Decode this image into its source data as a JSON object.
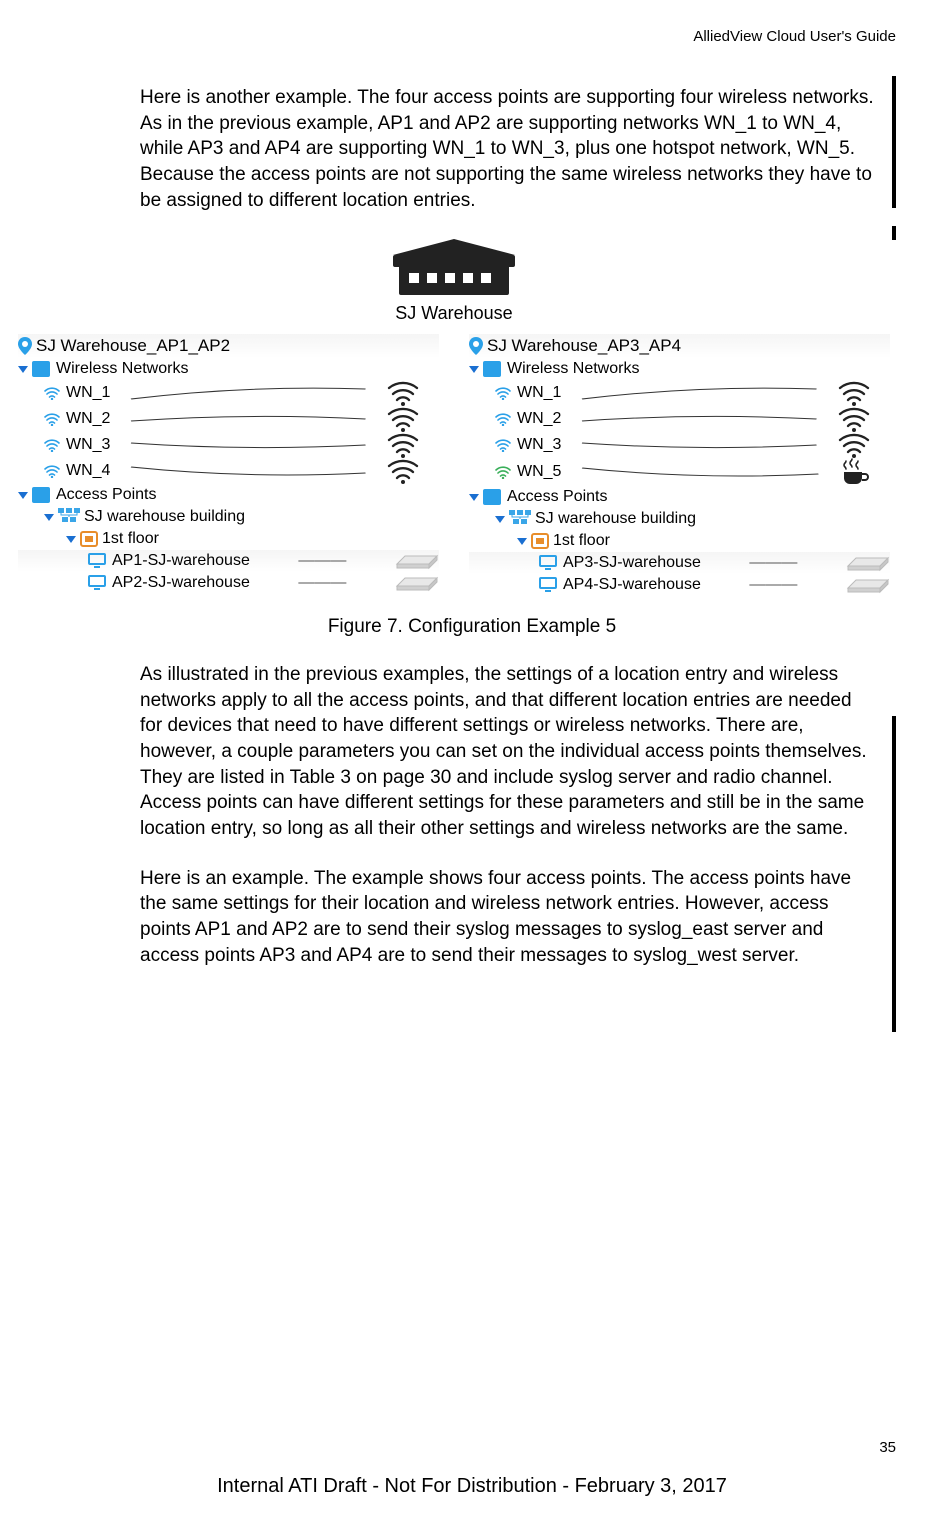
{
  "header": {
    "title": "AlliedView Cloud User's Guide"
  },
  "paragraphs": {
    "p1": "Here is another example. The four access points are supporting four wireless networks. As in the previous example, AP1 and AP2 are supporting networks WN_1 to WN_4, while AP3 and AP4 are supporting WN_1 to WN_3, plus one hotspot network, WN_5. Because the access points are not supporting the same wireless networks they have to be assigned to different location entries.",
    "p2": "As illustrated in the previous examples, the settings of a location entry and wireless networks apply to all the access points, and that different location entries are needed for devices that need to have different settings or wireless networks. There are, however, a couple parameters you can set on the individual access points themselves. They are listed in Table 3 on page 30 and include syslog server and radio channel. Access points can have different settings for these parameters and still be in the same location entry, so long as all their other settings and wireless networks are the same.",
    "p3": "Here is an example. The example shows four access points. The access points have the same settings for their location and wireless network entries. However, access points AP1 and AP2 are to send their syslog messages to syslog_east server and access points AP3 and AP4 are to send their messages to syslog_west server."
  },
  "figure": {
    "caption": "Figure 7. Configuration Example 5",
    "building_label": "SJ Warehouse",
    "left": {
      "location": "SJ Warehouse_AP1_AP2",
      "wireless_label": "Wireless Networks",
      "networks": [
        "WN_1",
        "WN_2",
        "WN_3",
        "WN_4"
      ],
      "ap_label": "Access Points",
      "building": "SJ warehouse building",
      "floor": "1st floor",
      "aps": [
        "AP1-SJ-warehouse",
        "AP2-SJ-warehouse"
      ]
    },
    "right": {
      "location": "SJ Warehouse_AP3_AP4",
      "wireless_label": "Wireless Networks",
      "networks": [
        "WN_1",
        "WN_2",
        "WN_3",
        "WN_5"
      ],
      "ap_label": "Access Points",
      "building": "SJ warehouse building",
      "floor": "1st floor",
      "aps": [
        "AP3-SJ-warehouse",
        "AP4-SJ-warehouse"
      ]
    }
  },
  "page_number": "35",
  "footer": "Internal ATI Draft - Not For Distribution - February 3, 2017"
}
